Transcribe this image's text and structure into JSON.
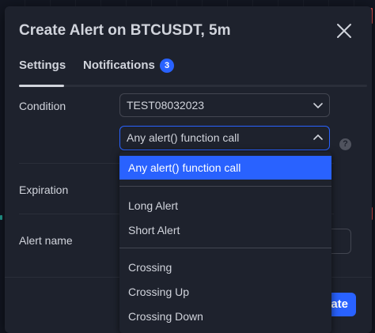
{
  "dialog": {
    "title": "Create Alert on BTCUSDT, 5m"
  },
  "tabs": [
    {
      "label": "Settings",
      "active": true
    },
    {
      "label": "Notifications",
      "badge": "3"
    }
  ],
  "condition": {
    "label": "Condition",
    "primary_value": "TEST08032023",
    "secondary_value": "Any alert() function call"
  },
  "expiration": {
    "label": "Expiration"
  },
  "alert_name": {
    "label": "Alert name"
  },
  "footer": {
    "create_label": "Create",
    "create_visible_text": "ate"
  },
  "dropdown": {
    "options": [
      {
        "label": "Any alert() function call",
        "selected": true
      },
      {
        "label": "Long Alert"
      },
      {
        "label": "Short Alert"
      },
      {
        "label": "Crossing"
      },
      {
        "label": "Crossing Up"
      },
      {
        "label": "Crossing Down"
      }
    ]
  },
  "colors": {
    "accent": "#2962ff",
    "dialog_bg": "#1e222d",
    "page_bg": "#131722",
    "text": "#d1d4dc"
  }
}
